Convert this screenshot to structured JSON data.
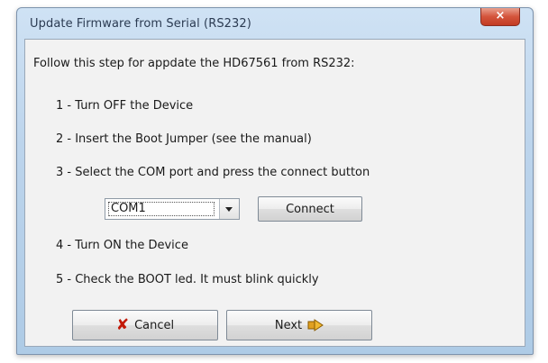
{
  "window": {
    "title": "Update Firmware from Serial (RS232)",
    "close_glyph": "×"
  },
  "content": {
    "intro": "Follow this step for appdate the HD67561 from RS232:",
    "steps": [
      "1 - Turn OFF the Device",
      "2 - Insert the Boot Jumper (see the manual)",
      "3 - Select the  COM port and press the connect button",
      "4 - Turn ON the Device",
      "5 - Check the BOOT led. It must blink quickly"
    ]
  },
  "com_select": {
    "value": "COM1",
    "arrow_icon": "chevron-down-icon"
  },
  "buttons": {
    "connect": "Connect",
    "cancel": "Cancel",
    "cancel_icon": "red-x-icon",
    "next": "Next",
    "next_icon": "next-arrow-icon"
  },
  "colors": {
    "title_bar": "#bcd4ec",
    "close_button": "#c23b22",
    "cancel_icon": "#c21807",
    "next_icon": "#e0a020"
  }
}
